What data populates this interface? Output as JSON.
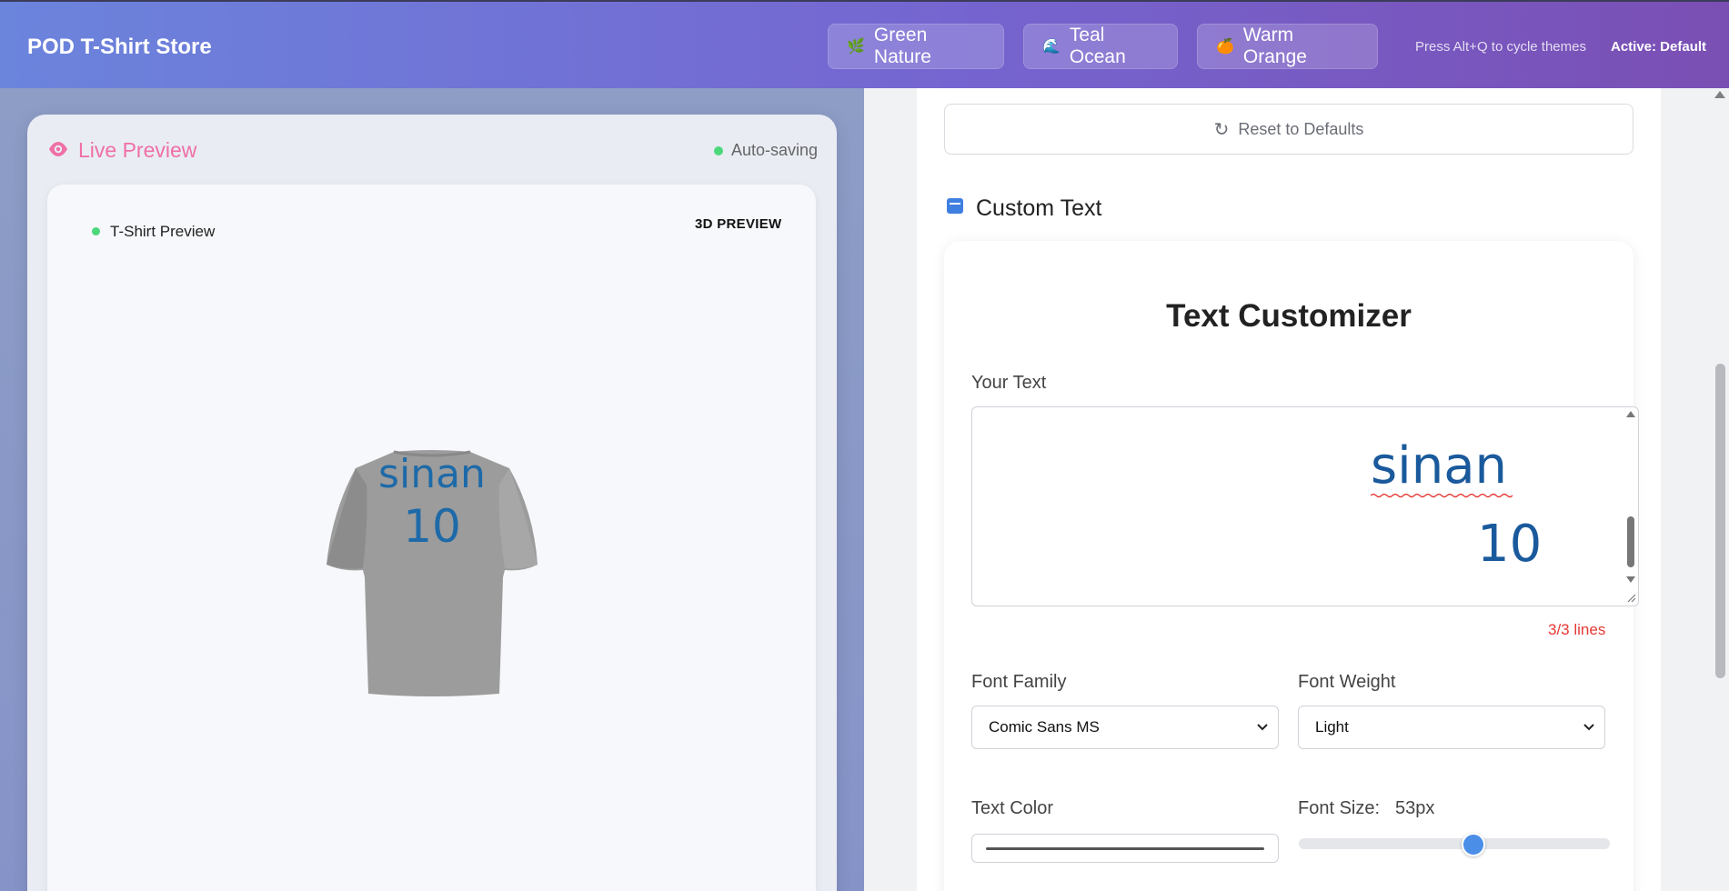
{
  "header": {
    "brand": "POD T-Shirt Store",
    "themes": [
      {
        "label": "Green Nature",
        "icon": "🌿"
      },
      {
        "label": "Teal Ocean",
        "icon": "🌊"
      },
      {
        "label": "Warm Orange",
        "icon": "🍊"
      }
    ],
    "hint": "Press Alt+Q to cycle themes",
    "active": "Active: Default"
  },
  "preview": {
    "title": "Live Preview",
    "status": "Auto-saving",
    "card_label": "T-Shirt Preview",
    "badge": "3D PREVIEW",
    "shirt_text_line1": "sinan",
    "shirt_text_line2": "10",
    "shirt_color": "#9a9a9a",
    "text_color": "#1e6aa8"
  },
  "panel": {
    "reset_label": "Reset to Defaults",
    "section_title": "Custom Text",
    "customizer_title": "Text Customizer",
    "your_text_label": "Your Text",
    "text_line1": "sinan",
    "text_line2": "10",
    "line_count": "3/3 lines",
    "font_family_label": "Font Family",
    "font_family_value": "Comic Sans MS",
    "font_weight_label": "Font Weight",
    "font_weight_value": "Light",
    "text_color_label": "Text Color",
    "font_size_label": "Font Size:",
    "font_size_value": "53px",
    "font_size_fraction": 0.56
  }
}
